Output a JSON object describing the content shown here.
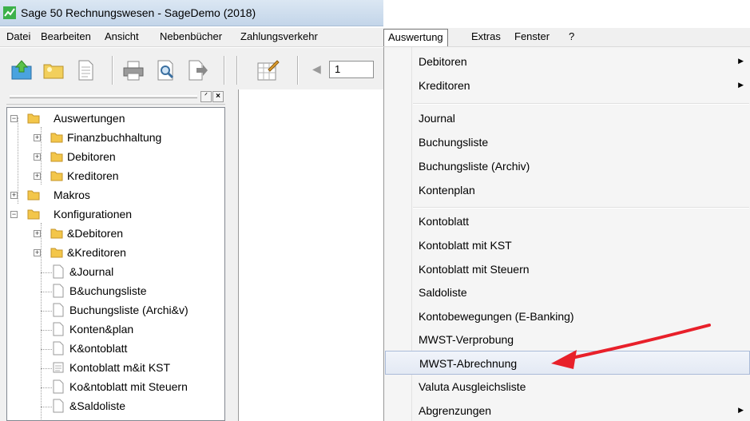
{
  "window": {
    "title": "Sage 50 Rechnungswesen - SageDemo (2018)",
    "app_icon": "sage-logo-icon"
  },
  "menubar": {
    "items": [
      "Datei",
      "Bearbeiten",
      "Ansicht",
      "Nebenbücher",
      "Zahlungsverkehr",
      "Auswertung",
      "Extras",
      "Fenster",
      "?"
    ],
    "active": "Auswertung"
  },
  "toolbar": {
    "buttons": [
      "open-icon",
      "folder-icon",
      "document-icon",
      "print-icon",
      "print-preview-icon",
      "export-icon",
      "edit-table-icon"
    ],
    "nav_prev_icon": "left-arrow-icon",
    "page_value": "1"
  },
  "panel": {
    "pin_icon": "pin-icon",
    "close_icon": "close-icon"
  },
  "tree": {
    "items": [
      {
        "label": "Auswertungen",
        "kind": "folder",
        "expander": "−"
      },
      {
        "label": "Finanzbuchhaltung",
        "kind": "folder",
        "expander": "+"
      },
      {
        "label": "Debitoren",
        "kind": "folder",
        "expander": "+"
      },
      {
        "label": "Kreditoren",
        "kind": "folder",
        "expander": "+"
      },
      {
        "label": "Makros",
        "kind": "folder",
        "expander": "+"
      },
      {
        "label": "Konfigurationen",
        "kind": "folder",
        "expander": "−"
      },
      {
        "label": "&Debitoren",
        "kind": "folder",
        "expander": "+"
      },
      {
        "label": "&Kreditoren",
        "kind": "folder",
        "expander": "+"
      },
      {
        "label": "&Journal",
        "kind": "document"
      },
      {
        "label": "B&uchungsliste",
        "kind": "document"
      },
      {
        "label": "Buchungsliste (Archi&v)",
        "kind": "document"
      },
      {
        "label": "Konten&plan",
        "kind": "document"
      },
      {
        "label": "K&ontoblatt",
        "kind": "document"
      },
      {
        "label": "Kontoblatt m&it KST",
        "kind": "document"
      },
      {
        "label": "Ko&ntoblatt mit Steuern",
        "kind": "document"
      },
      {
        "label": "&Saldoliste",
        "kind": "document"
      }
    ]
  },
  "dropdown": {
    "items": [
      {
        "label": "Debitoren",
        "submenu": true
      },
      {
        "label": "Kreditoren",
        "submenu": true
      },
      {
        "label": "Journal",
        "submenu": false
      },
      {
        "label": "Buchungsliste",
        "submenu": false
      },
      {
        "label": "Buchungsliste (Archiv)",
        "submenu": false
      },
      {
        "label": "Kontenplan",
        "submenu": false
      },
      {
        "label": "Kontoblatt",
        "submenu": false
      },
      {
        "label": "Kontoblatt mit KST",
        "submenu": false
      },
      {
        "label": "Kontoblatt mit Steuern",
        "submenu": false
      },
      {
        "label": "Saldoliste",
        "submenu": false
      },
      {
        "label": "Kontobewegungen (E-Banking)",
        "submenu": false
      },
      {
        "label": "MWST-Verprobung",
        "submenu": false
      },
      {
        "label": "MWST-Abrechnung",
        "submenu": false,
        "highlighted": true
      },
      {
        "label": "Valuta Ausgleichsliste",
        "submenu": false
      },
      {
        "label": "Abgrenzungen",
        "submenu": true
      }
    ],
    "submenu_arrow": "▶",
    "annotation_color": "#e8202a"
  }
}
